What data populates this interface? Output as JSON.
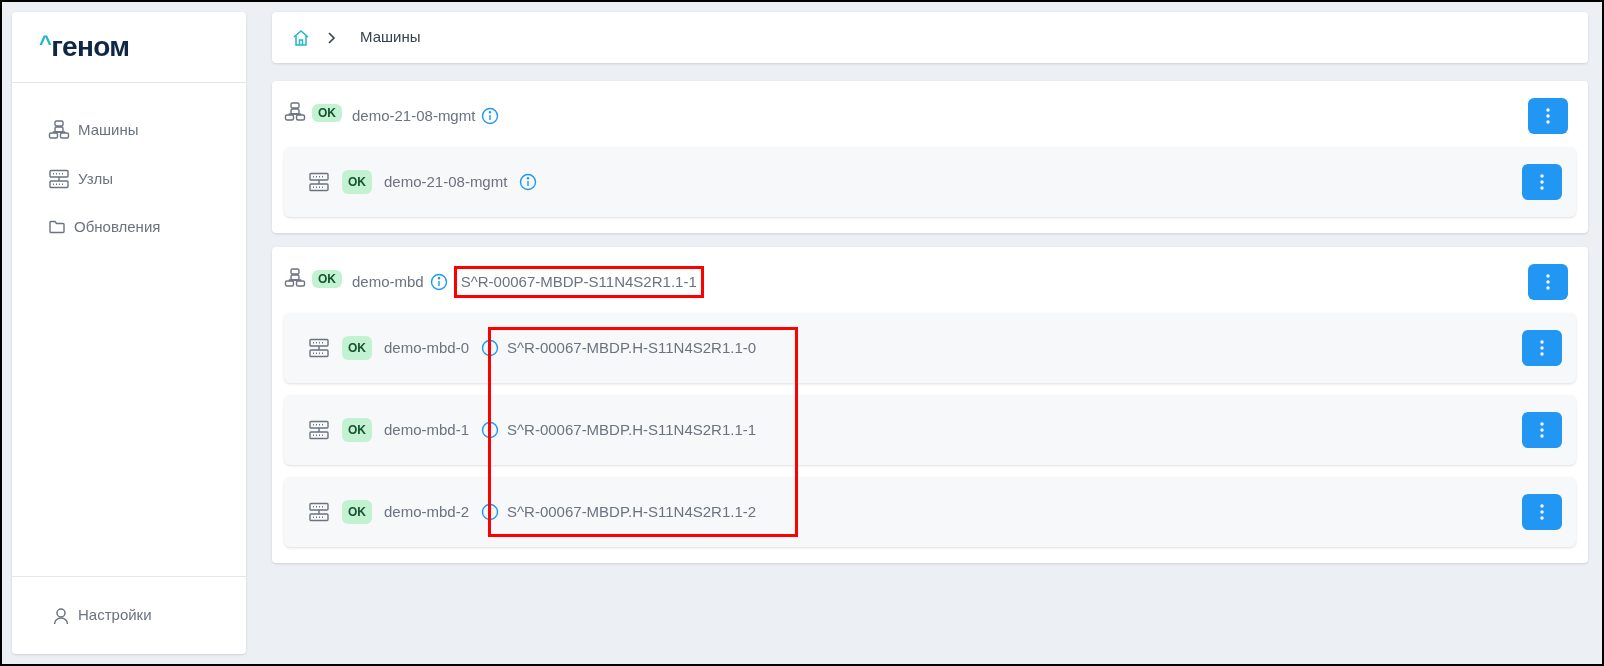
{
  "logo": {
    "mark": "^",
    "name": "геном"
  },
  "sidebar": {
    "items": [
      {
        "label": "Машины",
        "kind": "machines",
        "selected": false
      },
      {
        "label": "Узлы",
        "kind": "nodes",
        "selected": false
      },
      {
        "label": "Обновления",
        "kind": "folder",
        "selected": false
      }
    ],
    "footer": {
      "label": "Настройки"
    }
  },
  "breadcrumb": {
    "current": "Машины"
  },
  "machines": [
    {
      "name": "demo-21-08-mgmt",
      "status": "OK",
      "nodes": [
        {
          "name": "demo-21-08-mgmt",
          "status": "OK"
        }
      ]
    },
    {
      "name": "demo-mbd",
      "status": "OK",
      "serial": "S^R-00067-MBDP-S11N4S2R1.1-1",
      "serial_highlighted": true,
      "nodes_highlighted": true,
      "nodes": [
        {
          "name": "demo-mbd-0",
          "status": "OK",
          "serial": "S^R-00067-MBDP.H-S11N4S2R1.1-0"
        },
        {
          "name": "demo-mbd-1",
          "status": "OK",
          "serial": "S^R-00067-MBDP.H-S11N4S2R1.1-1"
        },
        {
          "name": "demo-mbd-2",
          "status": "OK",
          "serial": "S^R-00067-MBDP.H-S11N4S2R1.1-2"
        }
      ]
    }
  ]
}
